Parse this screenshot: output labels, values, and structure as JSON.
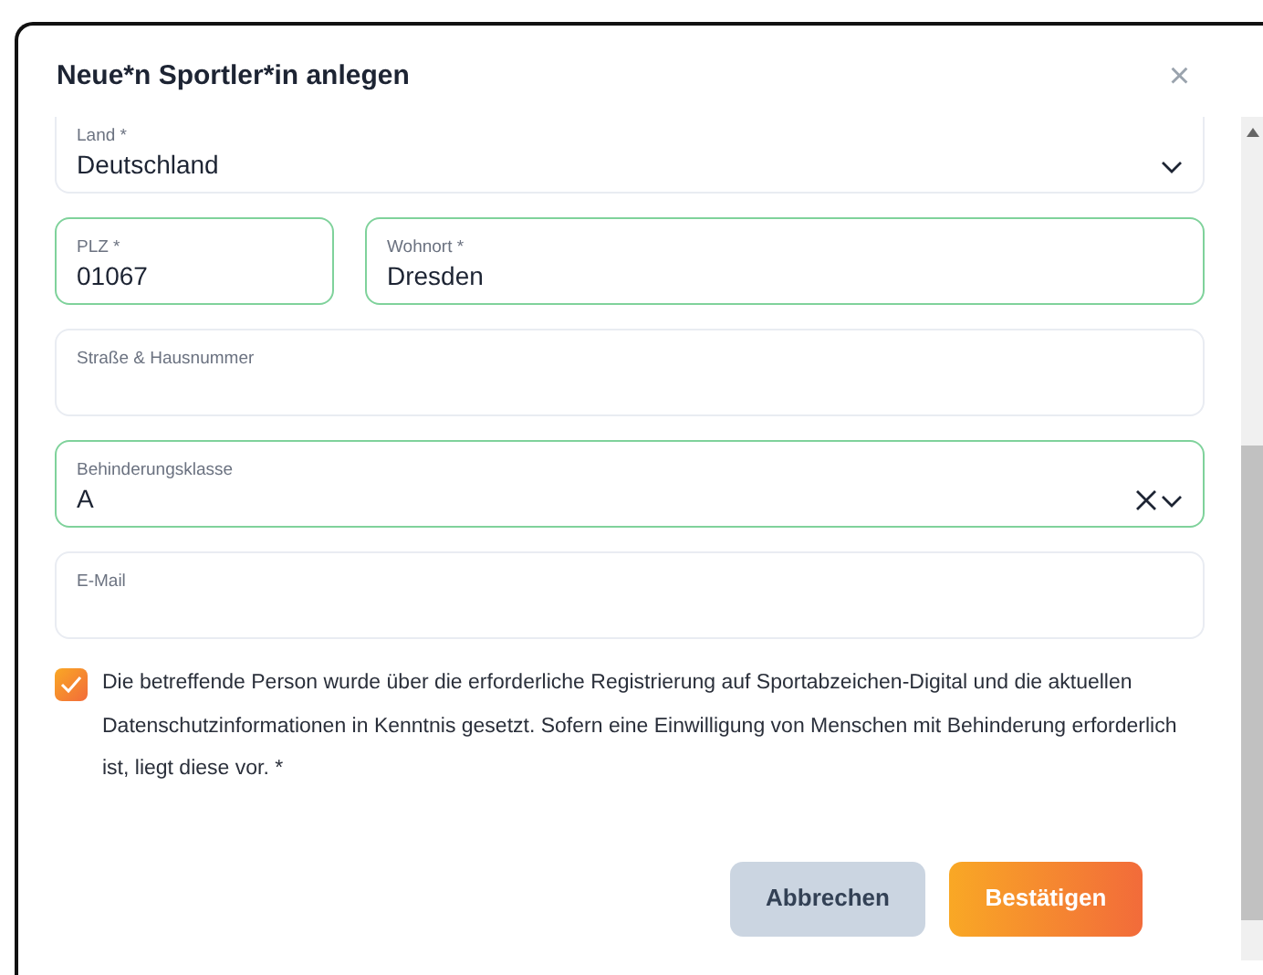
{
  "dialog": {
    "title": "Neue*n Sportler*in anlegen",
    "close": "×"
  },
  "field_rows": [
    [
      {
        "label": "Land *",
        "value": "Deutschland",
        "kind": "select",
        "valid": false
      }
    ],
    [
      {
        "label": "PLZ *",
        "value": "01067",
        "kind": "text",
        "valid": true
      },
      {
        "label": "Wohnort *",
        "value": "Dresden",
        "kind": "text",
        "valid": true
      }
    ],
    [
      {
        "label": "Straße & Hausnummer",
        "kind": "text",
        "valid": false
      }
    ],
    [
      {
        "label": "Behinderungsklasse",
        "value": "A",
        "kind": "select",
        "valid": true,
        "clearable": true
      }
    ],
    [
      {
        "label": "E-Mail",
        "kind": "text",
        "valid": false
      }
    ]
  ],
  "consent": {
    "checked": true,
    "text": "Die betreffende Person wurde über die erforderliche Registrierung auf Sportabzeichen-Digital und die aktuellen Datenschutzinformationen in Kenntnis gesetzt. Sofern eine Einwilligung von Menschen mit Behinderung erforderlich ist, liegt diese vor. *"
  },
  "buttons": [
    {
      "label": "Abbrechen",
      "kind": "secondary"
    },
    {
      "label": "Bestätigen",
      "kind": "primary"
    }
  ]
}
